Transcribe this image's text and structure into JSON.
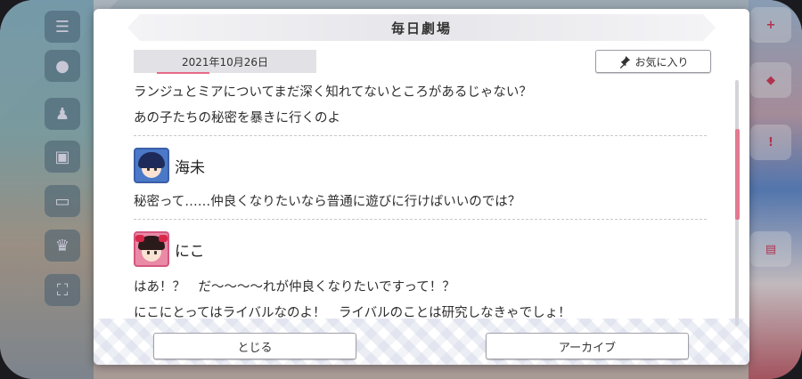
{
  "dialog": {
    "title": "毎日劇場",
    "date": "2021年10月26日",
    "favorite_label": "お気に入り",
    "close_label": "とじる",
    "archive_label": "アーカイブ"
  },
  "story": {
    "intro_lines": [
      "ランジュとミアについてまだ深く知れてないところがあるじゃない？",
      "あの子たちの秘密を暴きに行くのよ"
    ],
    "entries": [
      {
        "speaker": "海未",
        "lines": [
          "秘密って……仲良くなりたいなら普通に遊びに行けばいいのでは？"
        ]
      },
      {
        "speaker": "にこ",
        "lines": [
          "はあ！？　だ～～～～れが仲良くなりたいですって！？",
          "にこにとってはライバルなのよ！　ライバルのことは研究しなきゃでしょ！"
        ]
      }
    ]
  },
  "icons": {
    "favorite": "pin-icon"
  },
  "colors": {
    "accent": "#e27a92",
    "dialog_bg": "#ffffff"
  }
}
